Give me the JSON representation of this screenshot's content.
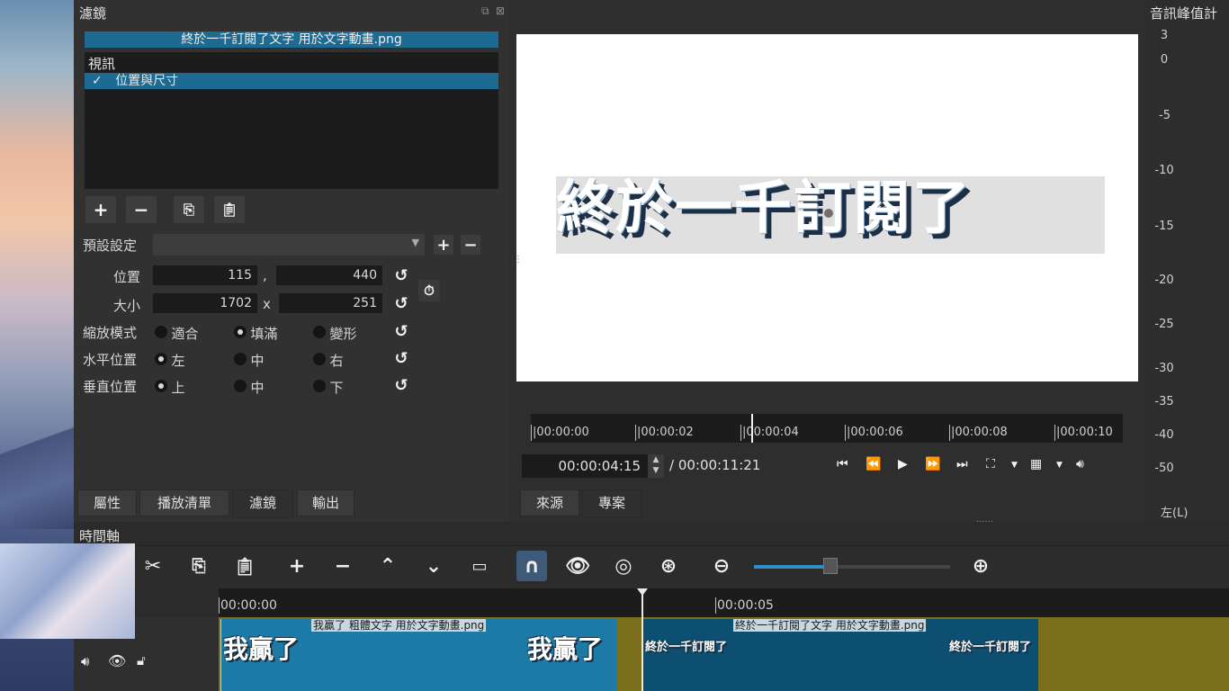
{
  "filters_panel": {
    "title": "濾鏡",
    "clip_name": "終於一千訂閱了文字 用於文字動畫.png",
    "category": "視訊",
    "active_filter": {
      "check": "✓",
      "label": "位置與尺寸"
    },
    "preset_label": "預設設定",
    "position": {
      "label": "位置",
      "x": "115",
      "sep": ",",
      "y": "440"
    },
    "size": {
      "label": "大小",
      "w": "1702",
      "sep": "x",
      "h": "251"
    },
    "fit_mode": {
      "label": "縮放模式",
      "options": [
        "適合",
        "填滿",
        "變形"
      ],
      "selected": "填滿"
    },
    "h_align": {
      "label": "水平位置",
      "options": [
        "左",
        "中",
        "右"
      ],
      "selected": "左"
    },
    "v_align": {
      "label": "垂直位置",
      "options": [
        "上",
        "中",
        "下"
      ],
      "selected": "上"
    }
  },
  "left_tabs": [
    "屬性",
    "播放清單",
    "濾鏡",
    "輸出"
  ],
  "viewer": {
    "preview_text": "終於一千訂閱了",
    "ruler_ticks": [
      "|00:00:00",
      "|00:00:02",
      "|00:00:04",
      "|00:00:06",
      "|00:00:08",
      "|00:00:10"
    ],
    "current_time": "00:00:04:15",
    "total_time": "/ 00:00:11:21",
    "tabs": [
      "來源",
      "專案"
    ]
  },
  "audio_meter": {
    "title": "音訊峰值計",
    "scale": [
      "3",
      "0",
      "-5",
      "-10",
      "-15",
      "-20",
      "-25",
      "-30",
      "-35",
      "-40",
      "-50"
    ],
    "channel": "左(L)"
  },
  "timeline": {
    "title": "時間軸",
    "ruler": [
      "00:00:00",
      "00:00:05"
    ],
    "clips": [
      {
        "name": "我贏了 粗體文字 用於文字動畫.png",
        "thumb_text": "我贏了"
      },
      {
        "name": "終於一千訂閱了文字 用於文字動畫.png",
        "thumb_text": "終於一千訂閱了"
      }
    ]
  },
  "colors": {
    "accent": "#1d6a93",
    "clip1": "#1d7aa6",
    "clip2": "#0d4f70",
    "track": "#7b6f1d"
  }
}
